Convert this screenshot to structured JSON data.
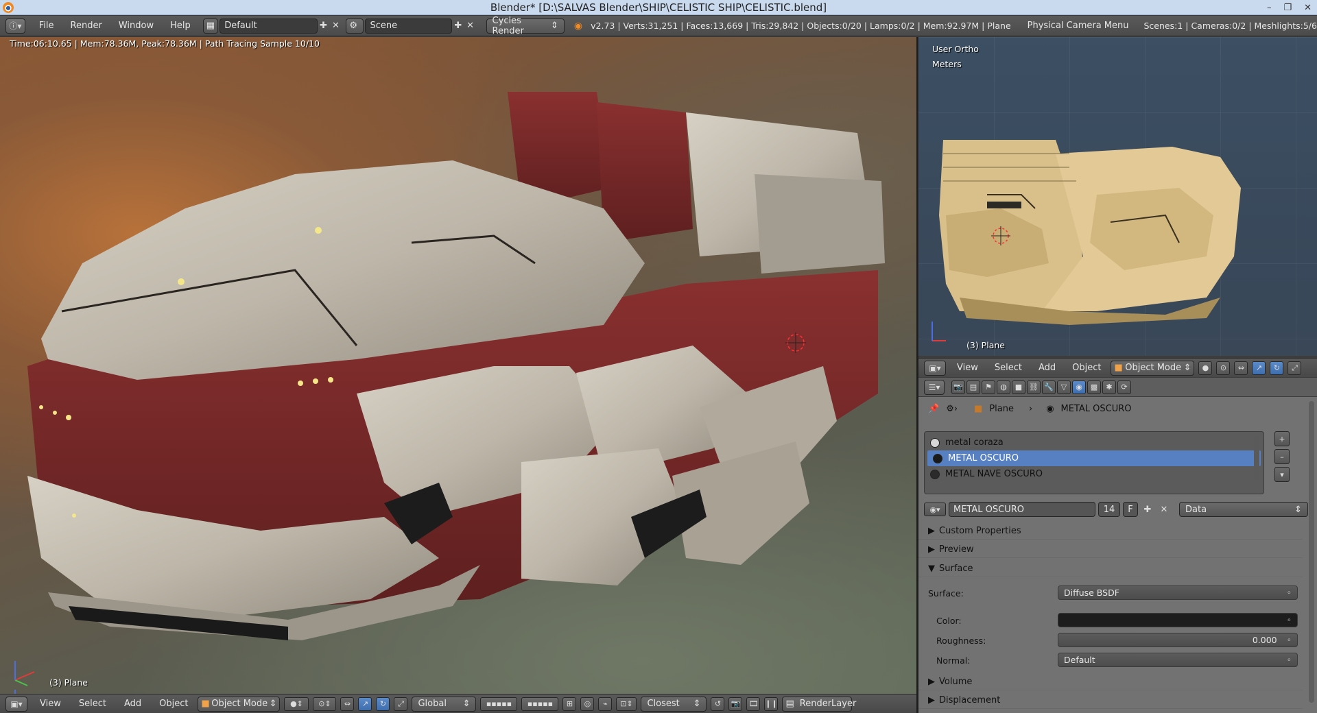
{
  "window": {
    "title": "Blender* [D:\\SALVAS Blender\\SHIP\\CELISTIC SHIP\\CELISTIC.blend]",
    "minimize": "–",
    "restore": "❐",
    "close": "✕"
  },
  "info_header": {
    "menus": [
      "File",
      "Render",
      "Window",
      "Help"
    ],
    "layout": "Default",
    "scene": "Scene",
    "engine": "Cycles Render",
    "stats": "v2.73 | Verts:31,251 | Faces:13,669 | Tris:29,842 | Objects:0/20 | Lamps:0/2 | Mem:92.97M | Plane",
    "physical_camera_menu": "Physical Camera Menu",
    "scene_stats": "Scenes:1 | Cameras:0/2 | Meshlights:5/6"
  },
  "main_viewport": {
    "render_info": "Time:06:10.65 | Mem:78.36M, Peak:78.36M | Path Tracing Sample 10/10",
    "object_label": "(3) Plane"
  },
  "main_footer": {
    "menus": [
      "View",
      "Select",
      "Add",
      "Object"
    ],
    "mode": "Object Mode",
    "orientation": "Global",
    "snap": "Closest",
    "render_layer": "RenderLayer"
  },
  "right_viewport": {
    "view_name": "User Ortho",
    "units": "Meters",
    "object_label": "(3) Plane"
  },
  "right_header": {
    "menus": [
      "View",
      "Select",
      "Add",
      "Object"
    ],
    "mode": "Object Mode"
  },
  "properties": {
    "breadcrumb": {
      "object": "Plane",
      "material": "METAL OSCURO"
    },
    "slots": [
      {
        "name": "metal coraza",
        "ball": "#d8d8d8",
        "active": false
      },
      {
        "name": "METAL OSCURO",
        "ball": "#1a1a1a",
        "active": true
      },
      {
        "name": "METAL NAVE  OSCURO",
        "ball": "#2b2b2b",
        "active": false
      }
    ],
    "material_name": "METAL OSCURO",
    "users": "14",
    "fake_user": "F",
    "link": "Data",
    "panels": {
      "custom_properties": "Custom Properties",
      "preview": "Preview",
      "surface": "Surface",
      "volume": "Volume",
      "displacement": "Displacement"
    },
    "surface": {
      "surface_label": "Surface:",
      "surface_value": "Diffuse BSDF",
      "color_label": "Color:",
      "roughness_label": "Roughness:",
      "roughness_value": "0.000",
      "normal_label": "Normal:",
      "normal_value": "Default"
    }
  },
  "colors": {
    "accent": "#5680c2",
    "header": "#4f4f4f",
    "panel": "#727272",
    "hull_red": "#7a2a2a",
    "hull_gray": "#b9b2a5"
  }
}
